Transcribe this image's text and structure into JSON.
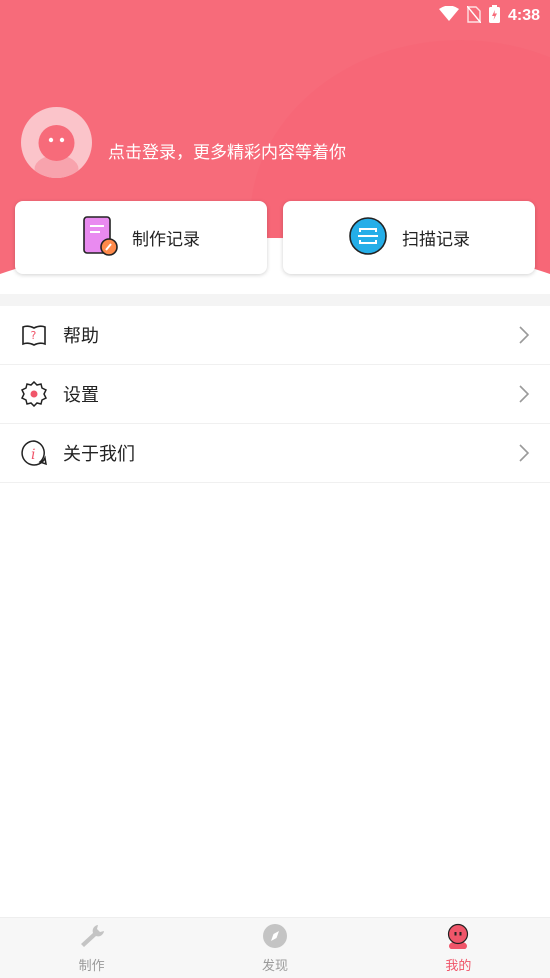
{
  "status_bar": {
    "time": "4:38"
  },
  "profile": {
    "login_prompt": "点击登录，更多精彩内容等着你"
  },
  "cards": {
    "make_record": "制作记录",
    "scan_record": "扫描记录"
  },
  "menu": [
    {
      "label": "帮助"
    },
    {
      "label": "设置"
    },
    {
      "label": "关于我们"
    }
  ],
  "bottom_nav": [
    {
      "label": "制作"
    },
    {
      "label": "发现"
    },
    {
      "label": "我的"
    }
  ],
  "colors": {
    "accent": "#f76b7a",
    "active_tab": "#f0566a",
    "inactive_tab": "#b5b5b5"
  }
}
